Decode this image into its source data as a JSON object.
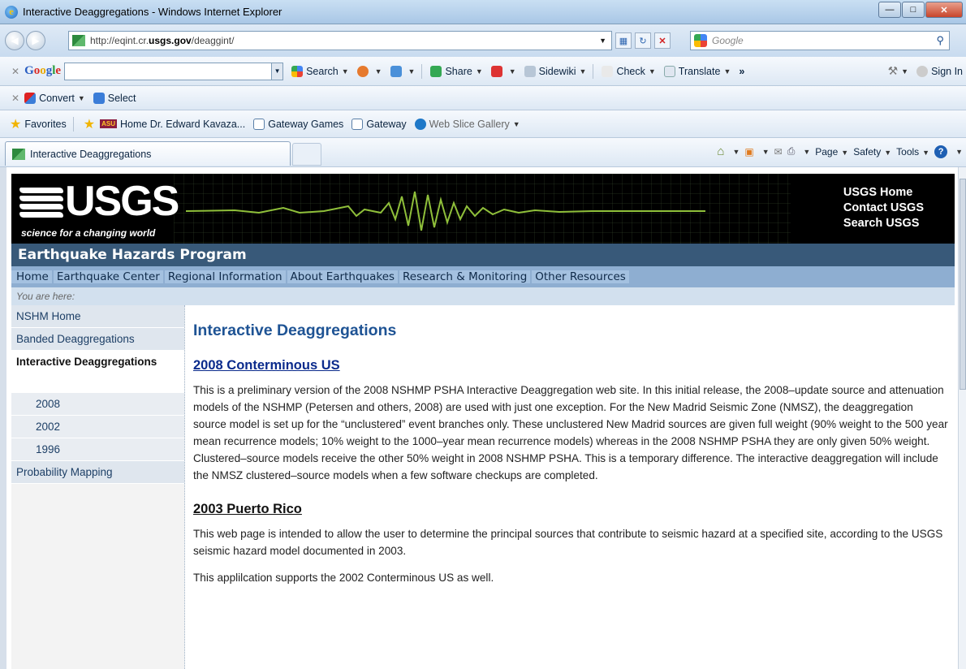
{
  "browser": {
    "window_title": "Interactive Deaggregations - Windows Internet Explorer",
    "url_prefix": "http://eqint.cr.",
    "url_domain": "usgs.gov",
    "url_path": "/deaggint/",
    "search_placeholder": "Google",
    "google_toolbar": {
      "brand_letters": [
        "G",
        "o",
        "o",
        "g",
        "l",
        "e"
      ],
      "search_label": "Search",
      "share_label": "Share",
      "sidewiki_label": "Sidewiki",
      "check_label": "Check",
      "translate_label": "Translate",
      "more": "»",
      "signin_label": "Sign In"
    },
    "convert_toolbar": {
      "convert_label": "Convert",
      "select_label": "Select"
    },
    "favorites_bar": {
      "favorites_label": "Favorites",
      "items": [
        "Home Dr. Edward Kavaza...",
        "Gateway Games",
        "Gateway",
        "Web Slice Gallery"
      ],
      "asu_badge": "ASU"
    },
    "tab_title": "Interactive Deaggregations",
    "command_bar": {
      "page_label": "Page",
      "safety_label": "Safety",
      "tools_label": "Tools"
    }
  },
  "site": {
    "agency": "USGS",
    "tagline": "science for a changing world",
    "header_links": [
      "USGS Home",
      "Contact USGS",
      "Search USGS"
    ],
    "program_title": "Earthquake Hazards Program",
    "top_nav": [
      "Home",
      "Earthquake Center",
      "Regional Information",
      "About Earthquakes",
      "Research & Monitoring",
      "Other Resources"
    ],
    "breadcrumb": "You are here:",
    "left_nav": {
      "nshm_home": "NSHM Home",
      "banded": "Banded Deaggregations",
      "current": "Interactive Deaggregations",
      "years": [
        "2008",
        "2002",
        "1996"
      ],
      "probability": "Probability Mapping"
    }
  },
  "content": {
    "page_title": "Interactive Deaggregations",
    "section1_title": "2008 Conterminous US",
    "section1_text": "This is a preliminary version of the 2008 NSHMP PSHA Interactive Deaggregation web site. In this initial release, the 2008–update source and attenuation models of the NSHMP (Petersen and others, 2008) are used with just one exception. For the New Madrid Seismic Zone (NMSZ), the deaggregation source model is set up for the “unclustered” event branches only. These unclustered New Madrid sources are given full weight (90% weight to the 500 year mean recurrence models; 10% weight to the 1000–year mean recurrence models) whereas in the 2008 NSHMP PSHA they are only given 50% weight. Clustered–source models receive the other 50% weight in 2008 NSHMP PSHA. This is a temporary difference. The interactive deaggregation will include the NMSZ clustered–source models when a few software checkups are completed.",
    "section2_title": "2003 Puerto Rico",
    "section2_text1": "This web page is intended to allow the user to determine the principal sources that contribute to seismic hazard at a specified site, according to the USGS seismic hazard model documented in 2003.",
    "section2_text2": "This applilcation supports the 2002 Conterminous US as well."
  }
}
